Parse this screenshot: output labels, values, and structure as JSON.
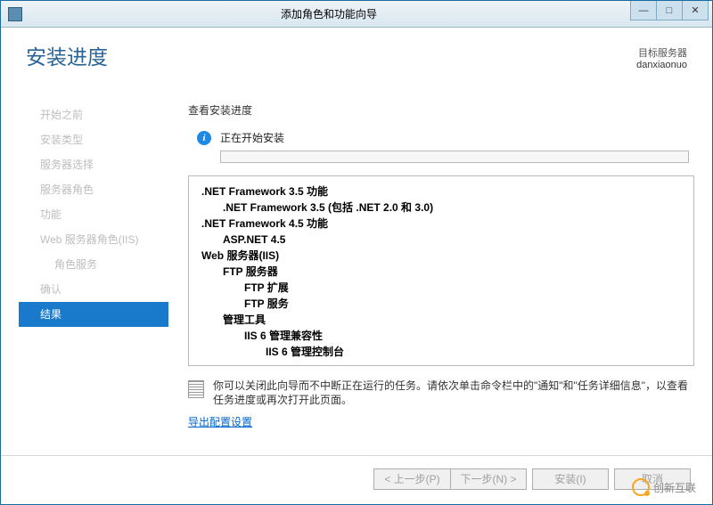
{
  "window": {
    "title": "添加角色和功能向导",
    "min_glyph": "—",
    "max_glyph": "□",
    "close_glyph": "✕"
  },
  "header": {
    "page_title": "安装进度",
    "target_label": "目标服务器",
    "target_name": "danxiaonuo"
  },
  "sidebar": {
    "items": [
      {
        "label": "开始之前",
        "indent": false
      },
      {
        "label": "安装类型",
        "indent": false
      },
      {
        "label": "服务器选择",
        "indent": false
      },
      {
        "label": "服务器角色",
        "indent": false
      },
      {
        "label": "功能",
        "indent": false
      },
      {
        "label": "Web 服务器角色(IIS)",
        "indent": false
      },
      {
        "label": "角色服务",
        "indent": true
      },
      {
        "label": "确认",
        "indent": false
      },
      {
        "label": "结果",
        "indent": false,
        "active": true
      }
    ]
  },
  "main": {
    "section_label": "查看安装进度",
    "info_glyph": "i",
    "status_text": "正在开始安装",
    "features": [
      {
        "level": 0,
        "text": ".NET Framework 3.5 功能"
      },
      {
        "level": 1,
        "text": ".NET Framework 3.5 (包括 .NET 2.0 和 3.0)"
      },
      {
        "level": 0,
        "text": ".NET Framework 4.5 功能"
      },
      {
        "level": 1,
        "text": "ASP.NET 4.5"
      },
      {
        "level": 0,
        "text": "Web 服务器(IIS)"
      },
      {
        "level": 1,
        "text": "FTP 服务器"
      },
      {
        "level": 2,
        "text": "FTP 扩展"
      },
      {
        "level": 2,
        "text": "FTP 服务"
      },
      {
        "level": 1,
        "text": "管理工具"
      },
      {
        "level": 2,
        "text": "IIS 6 管理兼容性"
      },
      {
        "level": 3,
        "text": "IIS 6 管理控制台"
      }
    ],
    "note_text": "你可以关闭此向导而不中断正在运行的任务。请依次单击命令栏中的\"通知\"和\"任务详细信息\"，以查看任务进度或再次打开此页面。",
    "export_link": "导出配置设置"
  },
  "footer": {
    "prev": "< 上一步(P)",
    "next": "下一步(N) >",
    "install": "安装(I)",
    "cancel": "取消"
  },
  "watermark": "创新互联"
}
